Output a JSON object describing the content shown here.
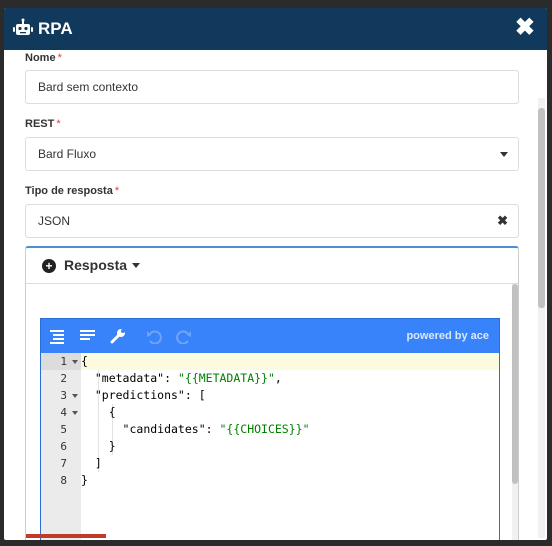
{
  "modal": {
    "title": "RPA",
    "close_icon": "close-icon",
    "robot_icon": "robot-icon"
  },
  "form": {
    "nome": {
      "label": "Nome",
      "required": "*",
      "value": "Bard sem contexto"
    },
    "rest": {
      "label": "REST",
      "required": "*",
      "value": "Bard Fluxo"
    },
    "tipo": {
      "label": "Tipo de resposta",
      "required": "*",
      "value": "JSON"
    }
  },
  "panel": {
    "title": "Resposta",
    "icon": "plus-circle-icon"
  },
  "editor": {
    "powered": "powered by ace",
    "toolbar_icons": [
      "format-icon",
      "compact-icon",
      "repair-icon",
      "undo-icon",
      "redo-icon"
    ],
    "line_numbers": [
      "1",
      "2",
      "3",
      "4",
      "5",
      "6",
      "7",
      "8"
    ],
    "lines": [
      "{",
      "  \"metadata\": \"{{METADATA}}\",",
      "  \"predictions\": [",
      "    {",
      "      \"candidates\": \"{{CHOICES}}\"",
      "    }",
      "  ]",
      "}"
    ]
  },
  "colors": {
    "header_bg": "#11395c",
    "accent": "#3883fa",
    "string": "#008000",
    "required": "#e53935"
  }
}
